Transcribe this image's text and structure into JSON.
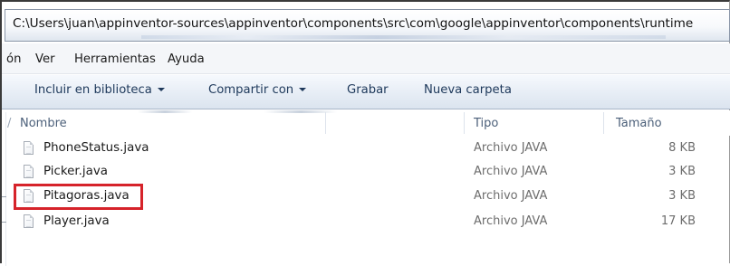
{
  "address_bar": {
    "path": "C:\\Users\\juan\\appinventor-sources\\appinventor\\components\\src\\com\\google\\appinventor\\components\\runtime"
  },
  "menu": {
    "items": [
      {
        "label": "ón"
      },
      {
        "label": "Ver"
      },
      {
        "label": "Herramientas"
      },
      {
        "label": "Ayuda"
      }
    ]
  },
  "toolbar": {
    "include_library": "Incluir en biblioteca",
    "share_with": "Compartir con",
    "burn": "Grabar",
    "new_folder": "Nueva carpeta"
  },
  "columns": {
    "name": "Nombre",
    "type": "Tipo",
    "size": "Tamaño"
  },
  "files": [
    {
      "name": "PhoneStatus.java",
      "type": "Archivo JAVA",
      "size": "8 KB"
    },
    {
      "name": "Picker.java",
      "type": "Archivo JAVA",
      "size": "3 KB"
    },
    {
      "name": "Pitagoras.java",
      "type": "Archivo JAVA",
      "size": "3 KB",
      "highlighted": true
    },
    {
      "name": "Player.java",
      "type": "Archivo JAVA",
      "size": "17 KB"
    }
  ],
  "colors": {
    "highlight_border": "#d6232a",
    "toolbar_text": "#1e395b",
    "column_header_text": "#4c607a",
    "secondary_text": "#6d6d6d"
  },
  "icons": {
    "file": "java-file-icon",
    "dropdown": "chevron-down-icon"
  }
}
